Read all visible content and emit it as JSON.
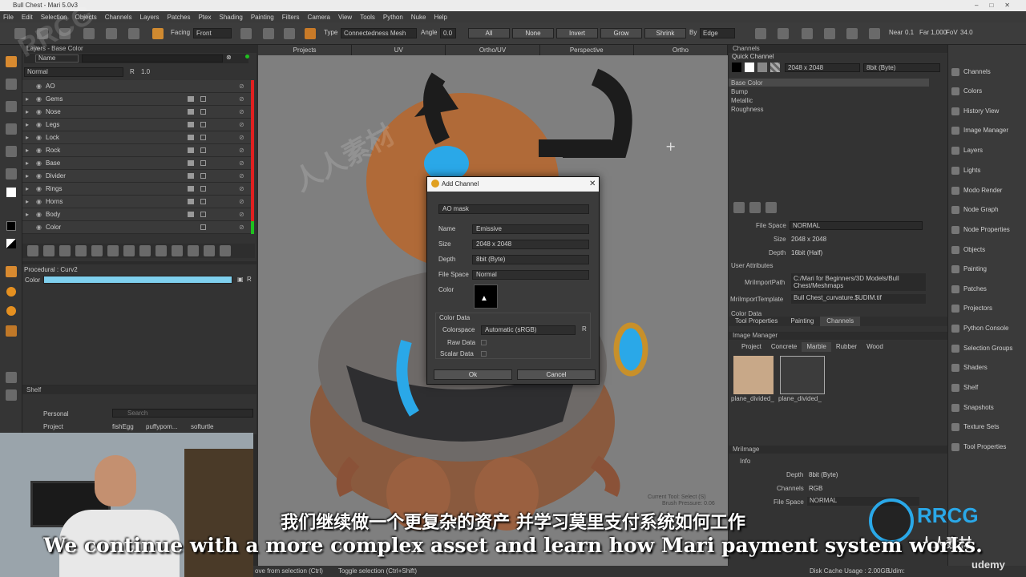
{
  "window": {
    "title": "Bull Chest - Mari 5.0v3"
  },
  "menu": [
    "File",
    "Edit",
    "Selection",
    "Objects",
    "Channels",
    "Layers",
    "Patches",
    "Ptex",
    "Shading",
    "Painting",
    "Filters",
    "Camera",
    "View",
    "Tools",
    "Python",
    "Nuke",
    "Help"
  ],
  "toolbar": {
    "facing_label": "Facing",
    "facing_value": "Front",
    "type_label": "Type",
    "type_value": "Connectedness Mesh",
    "angle_label": "Angle",
    "angle_value": "0.0",
    "all": "All",
    "none": "None",
    "invert": "Invert",
    "grow": "Grow",
    "shrink": "Shrink",
    "by_label": "By",
    "by_value": "Edge",
    "near_label": "Near",
    "near_value": "0.1",
    "far_label": "Far",
    "far_value": "1,000",
    "fov_label": "FoV",
    "fov_value": "34.0"
  },
  "layers_panel": {
    "title": "Layers - Base Color",
    "filter": "Name",
    "blend_mode": "Normal",
    "opacity": "1.0",
    "items": [
      "AO",
      "Gems",
      "Nose",
      "Legs",
      "Lock",
      "Rock",
      "Base",
      "Divider",
      "Rings",
      "Horns",
      "Body",
      "Color"
    ]
  },
  "procedural": {
    "title": "Procedural : Curv2",
    "color_label": "Color"
  },
  "shelf": {
    "title": "Shelf",
    "personal": "Personal",
    "project": "Project",
    "search_placeholder": "Search",
    "items": [
      "fishEgg",
      "puffypom...",
      "softurtle"
    ]
  },
  "viewport_tabs": [
    "Projects",
    "UV",
    "Ortho/UV",
    "Perspective",
    "Ortho"
  ],
  "dialog": {
    "title": "Add Channel",
    "preset": "AO mask",
    "name_label": "Name",
    "name_value": "Emissive",
    "size_label": "Size",
    "size_value": "2048 x 2048",
    "depth_label": "Depth",
    "depth_value": "8bit  (Byte)",
    "filespace_label": "File Space",
    "filespace_value": "Normal",
    "color_label": "Color",
    "color_data_label": "Color Data",
    "colorspace_label": "Colorspace",
    "colorspace_value": "Automatic (sRGB)",
    "raw_data_label": "Raw Data",
    "scalar_data_label": "Scalar Data",
    "ok": "Ok",
    "cancel": "Cancel"
  },
  "channels_panel": {
    "title": "Channels",
    "quick_channel": "Quick Channel",
    "size": "2048 x 2048",
    "depth": "8bit  (Byte)",
    "channels": [
      "Base Color",
      "Bump",
      "Metallic",
      "Roughness"
    ],
    "file_space_label": "File Space",
    "file_space_value": "NORMAL",
    "size_label": "Size",
    "size_value": "2048 x 2048",
    "depth_label": "Depth",
    "depth_value": "16bit (Half)",
    "user_attributes": "User Attributes",
    "mri_import_path_label": "MriImportPath",
    "mri_import_path_value": "C:/Mari for Beginners/3D Models/Bull Chest/Meshmaps",
    "mri_import_template_label": "MriImportTemplate",
    "mri_import_template_value": "Bull Chest_curvature.$UDIM.tif",
    "color_data": "Color Data",
    "tabs": [
      "Tool Properties",
      "Painting",
      "Channels"
    ]
  },
  "image_manager": {
    "title": "Image Manager",
    "tabs": [
      "Project",
      "Concrete",
      "Marble",
      "Rubber",
      "Wood"
    ],
    "thumbs": [
      "plane_divided_",
      "plane_divided_"
    ]
  },
  "mri_image": {
    "title": "MriImage",
    "info": "Info",
    "depth_label": "Depth",
    "depth_value": "8bit  (Byte)",
    "channels_label": "Channels",
    "channels_value": "RGB",
    "file_space_label": "File Space",
    "file_space_value": "NORMAL"
  },
  "right_tabs": [
    "Channels",
    "Colors",
    "History View",
    "Image Manager",
    "Layers",
    "Lights",
    "Modo Render",
    "Node Graph",
    "Node Properties",
    "Objects",
    "Painting",
    "Patches",
    "Projectors",
    "Python Console",
    "Selection Groups",
    "Shaders",
    "Shelf",
    "Snapshots",
    "Texture Sets",
    "Tool Properties"
  ],
  "viewport_status": {
    "current_tool": "Current Tool: Select (S)",
    "brush_pressure": "Brush Pressure: 0.06",
    "node_properties": "Node Properties"
  },
  "status": {
    "left": "ove from selection (Ctrl)",
    "middle": "Toggle selection (Ctrl+Shift)",
    "disk_cache": "Disk Cache Usage : 2.00GB",
    "udim": "Udim:"
  },
  "subtitles": {
    "cn": "我们继续做一个更复杂的资产 并学习莫里支付系统如何工作",
    "en": "We continue with a more complex asset and learn how Mari payment system works."
  },
  "watermarks": [
    "RRCG",
    "人人素材",
    "udemy",
    "RRCG",
    "人人素材"
  ],
  "colors": {
    "accent_red": "#e02020",
    "accent_green": "#20c020",
    "cyan_bar": "#7fd0ee",
    "gem_blue": "#2aa8e8"
  }
}
